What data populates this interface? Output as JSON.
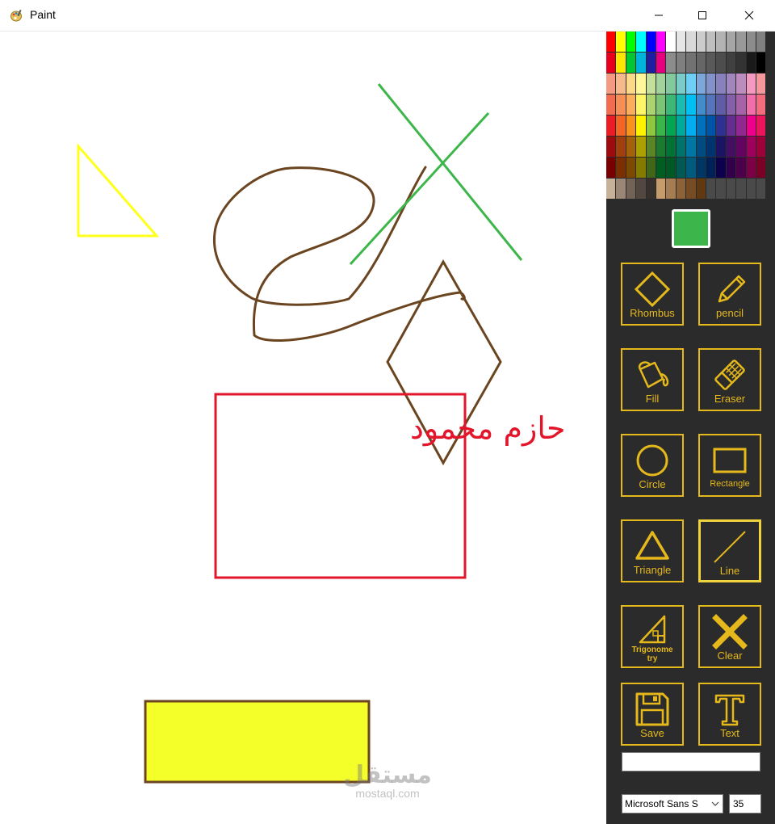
{
  "window": {
    "title": "Paint",
    "icon": "paint-palette-icon"
  },
  "window_controls": {
    "minimize": "minimize-icon",
    "maximize": "maximize-icon",
    "close": "close-icon"
  },
  "canvas": {
    "drawn_text": "حازم محمود",
    "drawn_text_color": "#e3152b",
    "shapes": [
      "yellow-triangle",
      "brown-freehand-scribble",
      "green-x-lines",
      "brown-rhombus",
      "red-rectangle",
      "yellow-filled-rectangle"
    ],
    "colors": {
      "yellow": "#ffff1a",
      "brown": "#6b4420",
      "green": "#3cb64a",
      "red": "#e3152b",
      "fill_yellow": "#f4ff2a"
    }
  },
  "palette": {
    "rows": [
      [
        "#ff0000",
        "#ffff00",
        "#00ff00",
        "#00ffff",
        "#0000ff",
        "#ff00ff",
        "#ffffff",
        "#e6e6e6",
        "#d9d9d9",
        "#cccccc",
        "#bfbfbf",
        "#b3b3b3",
        "#a6a6a6",
        "#999999",
        "#8c8c8c",
        "#808080"
      ],
      [
        "#e6001e",
        "#ffe600",
        "#00c832",
        "#00b4dc",
        "#1e1ea0",
        "#e6007e",
        "#8c8c8c",
        "#7f7f7f",
        "#727272",
        "#666666",
        "#595959",
        "#4d4d4d",
        "#404040",
        "#333333",
        "#1a1a1a",
        "#000000"
      ],
      [
        "#f49a82",
        "#f7b98b",
        "#fbd989",
        "#fff799",
        "#c4df9b",
        "#a3d39c",
        "#82ca9c",
        "#7accc8",
        "#6dcff6",
        "#7da7d9",
        "#8393ca",
        "#8781bd",
        "#a186be",
        "#bd8cbf",
        "#f49ac1",
        "#f5989d"
      ],
      [
        "#f26c4f",
        "#f68e56",
        "#fbaf5d",
        "#fff568",
        "#acd372",
        "#7cc576",
        "#3bb878",
        "#1abbb4",
        "#00bff3",
        "#438ccb",
        "#5574b9",
        "#605ca8",
        "#855fa8",
        "#a763a8",
        "#f06ea9",
        "#f26d7d"
      ],
      [
        "#ed1c24",
        "#f26522",
        "#f7941d",
        "#fff200",
        "#8dc63f",
        "#39b54a",
        "#00a651",
        "#00a99d",
        "#00aeef",
        "#0072bc",
        "#0054a6",
        "#2e3192",
        "#662d91",
        "#92278f",
        "#ec008c",
        "#ed145b"
      ],
      [
        "#9e0b0f",
        "#a0410d",
        "#a36209",
        "#aba000",
        "#598527",
        "#1a7b30",
        "#007236",
        "#00746b",
        "#0076a3",
        "#004b80",
        "#003471",
        "#1b1464",
        "#440e62",
        "#630460",
        "#9e005d",
        "#9e0039"
      ],
      [
        "#790000",
        "#7b2e00",
        "#7d4900",
        "#827b00",
        "#406618",
        "#005e20",
        "#005826",
        "#005952",
        "#005b7f",
        "#003663",
        "#002157",
        "#0d004c",
        "#32004b",
        "#4b0049",
        "#7b0046",
        "#7a0026"
      ],
      [
        "#c7b299",
        "#998675",
        "#736357",
        "#534741",
        "#37302d",
        "#c69c6d",
        "#a67c52",
        "#8c6239",
        "#754c24",
        "#603913",
        "#4a4a4a",
        "#4a4a4a",
        "#4a4a4a",
        "#4a4a4a",
        "#4a4a4a",
        "#4a4a4a"
      ]
    ]
  },
  "selected_color": "#3cb64a",
  "tools": {
    "rhombus": {
      "label": "Rhombus",
      "icon": "rhombus-icon"
    },
    "pencil": {
      "label": "pencil",
      "icon": "pencil-icon"
    },
    "fill": {
      "label": "Fill",
      "icon": "paint-bucket-icon"
    },
    "eraser": {
      "label": "Eraser",
      "icon": "eraser-icon"
    },
    "circle": {
      "label": "Circle",
      "icon": "circle-icon"
    },
    "rectangle": {
      "label": "Rectangle",
      "icon": "rectangle-icon"
    },
    "triangle": {
      "label": "Triangle",
      "icon": "triangle-icon"
    },
    "line": {
      "label": "Line",
      "icon": "line-icon"
    },
    "trigonometry": {
      "label": "Trigonometry",
      "label_line1": "Trigonome",
      "label_line2": "try",
      "icon": "right-triangle-icon"
    },
    "clear": {
      "label": "Clear",
      "icon": "x-icon"
    },
    "save": {
      "label": "Save",
      "icon": "floppy-disk-icon"
    },
    "text": {
      "label": "Text",
      "icon": "text-t-icon"
    }
  },
  "accent_color": "#e5b81b",
  "text_input": {
    "value": ""
  },
  "font_select": {
    "value": "Microsoft Sans S"
  },
  "font_size": {
    "value": "35"
  },
  "watermark": {
    "arabic": "مستقل",
    "latin": "mostaql.com"
  }
}
